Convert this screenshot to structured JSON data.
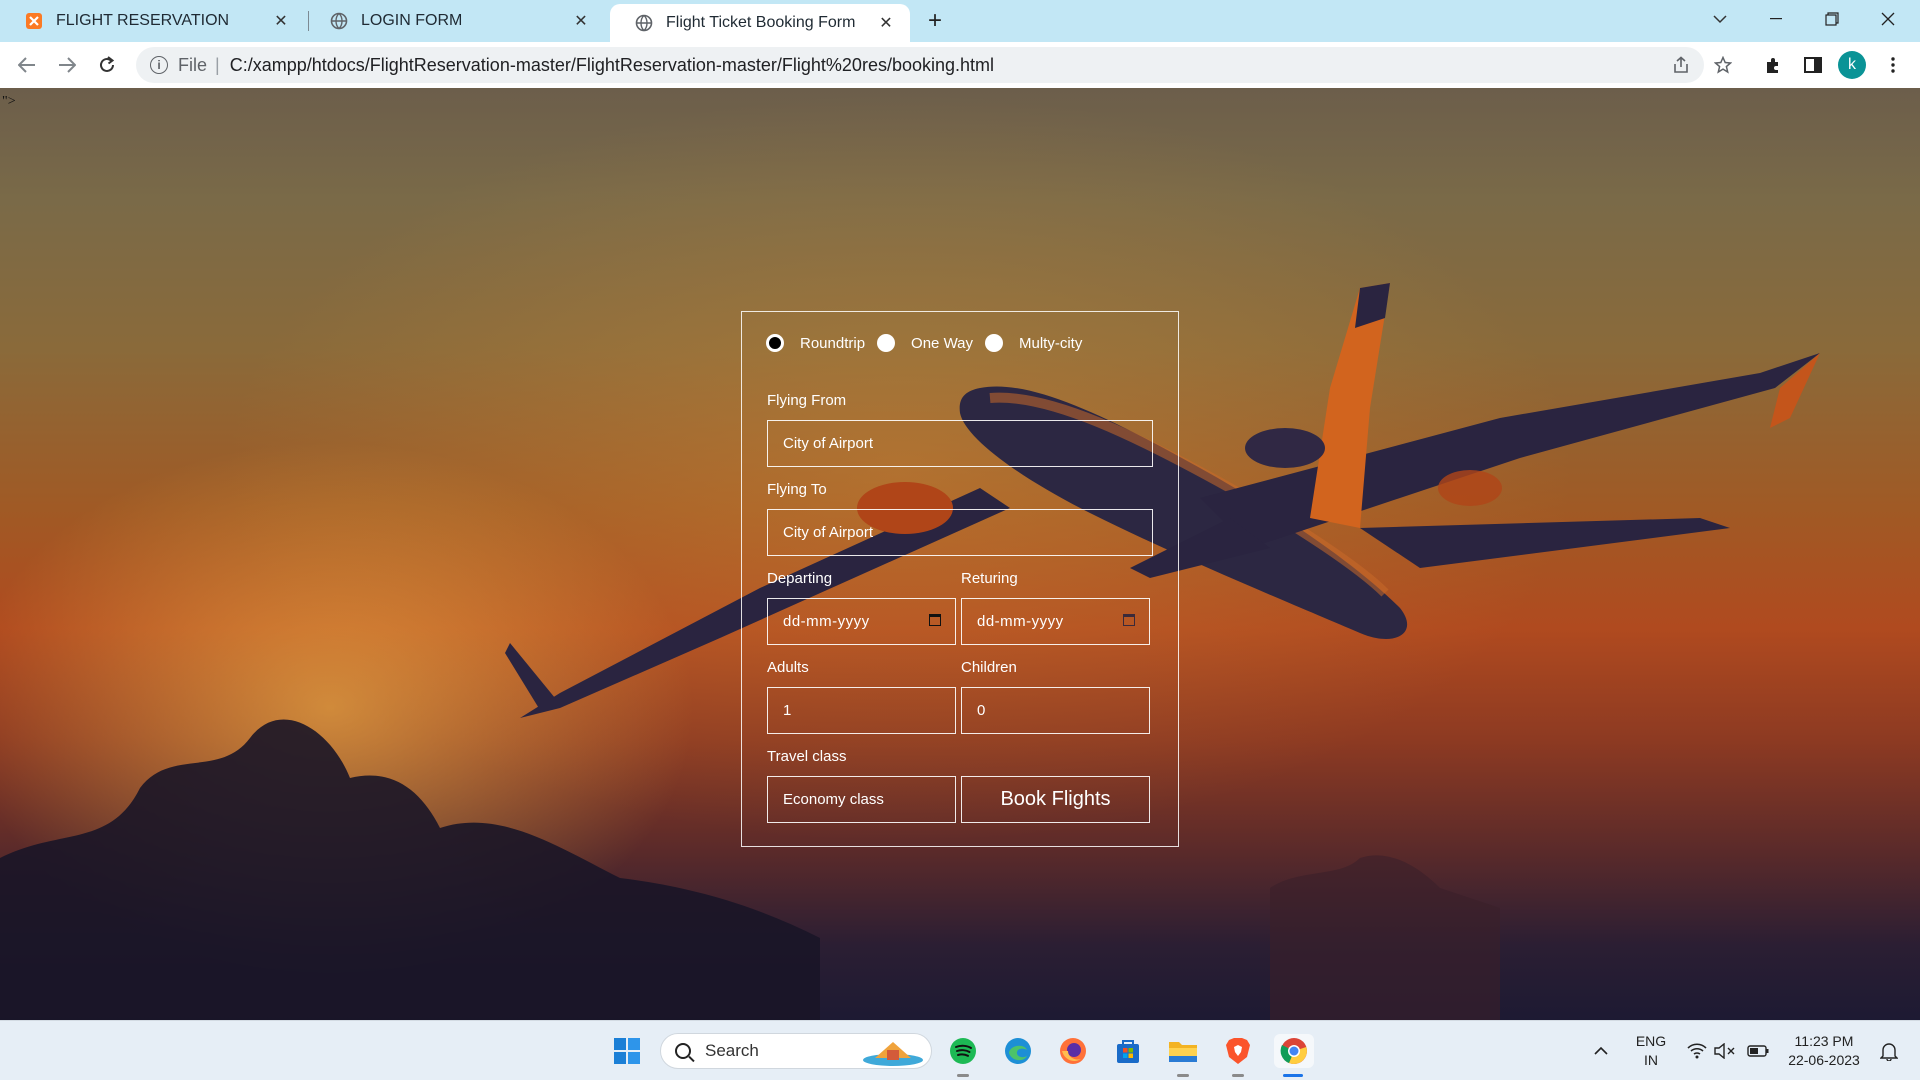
{
  "browser": {
    "tabs": [
      {
        "label": "FLIGHT RESERVATION",
        "icon": "xampp-icon"
      },
      {
        "label": "LOGIN FORM",
        "icon": "globe-icon"
      },
      {
        "label": "Flight Ticket Booking Form",
        "icon": "globe-icon",
        "active": true
      }
    ],
    "url_scheme": "File",
    "url": "C:/xampp/htdocs/FlightReservation-master/FlightReservation-master/Flight%20res/booking.html",
    "profile_initial": "k"
  },
  "page": {
    "stray_text": "\">",
    "trip_types": [
      {
        "label": "Roundtrip",
        "checked": true
      },
      {
        "label": "One Way",
        "checked": false
      },
      {
        "label": "Multy-city",
        "checked": false
      }
    ],
    "flying_from": {
      "label": "Flying From",
      "placeholder": "City of Airport"
    },
    "flying_to": {
      "label": "Flying To",
      "placeholder": "City of Airport"
    },
    "departing": {
      "label": "Departing",
      "placeholder": "dd-mm-yyyy"
    },
    "returning": {
      "label": "Returing",
      "placeholder": "dd-mm-yyyy"
    },
    "adults": {
      "label": "Adults",
      "value": "1"
    },
    "children": {
      "label": "Children",
      "value": "0"
    },
    "travel_class": {
      "label": "Travel class",
      "value": "Economy class"
    },
    "book_button": "Book Flights"
  },
  "taskbar": {
    "search_label": "Search",
    "lang_line1": "ENG",
    "lang_line2": "IN",
    "time": "11:23 PM",
    "date": "22-06-2023"
  }
}
